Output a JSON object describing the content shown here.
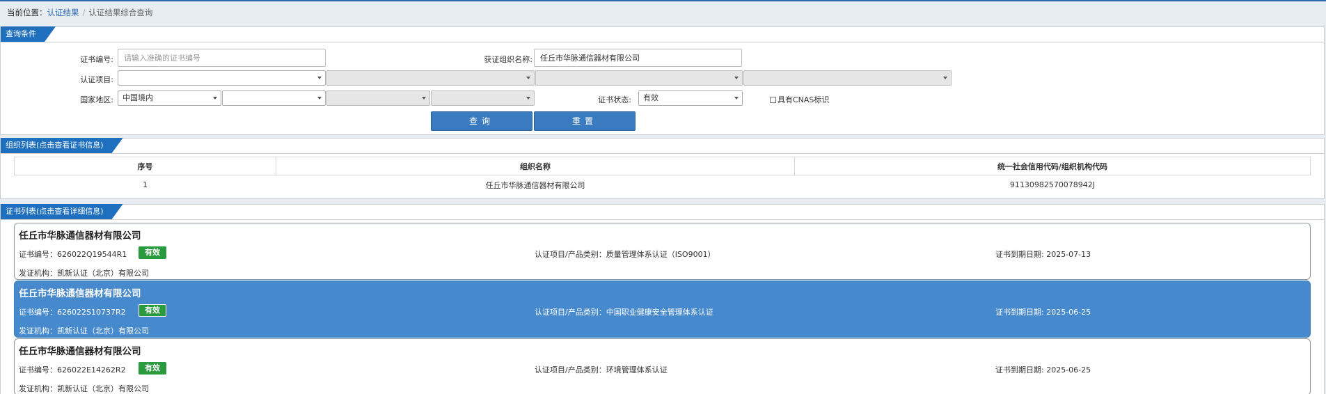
{
  "breadcrumb": {
    "prefix": "当前位置：",
    "link": "认证结果",
    "separator": "/",
    "current": "认证结果综合查询"
  },
  "query_panel": {
    "title": "查询条件",
    "cert_no_label": "证书编号:",
    "cert_no_value": "",
    "cert_no_placeholder": "请输入准确的证书编号",
    "org_name_label": "获证组织名称:",
    "org_name_value": "任丘市华脉通信器材有限公司",
    "cert_item_label": "认证项目:",
    "country_label": "国家地区:",
    "country_value": "中国境内",
    "status_label": "证书状态:",
    "status_value": "有效",
    "cnas_label": "具有CNAS标识",
    "search_button": "查询",
    "reset_button": "重置"
  },
  "org_panel": {
    "title": "组织列表(点击查看证书信息)",
    "columns": [
      "序号",
      "组织名称",
      "统一社会信用代码/组织机构代码"
    ],
    "rows": [
      {
        "index": "1",
        "name": "任丘市华脉通信器材有限公司",
        "code": "91130982570078942J"
      }
    ]
  },
  "cert_panel": {
    "title": "证书列表(点击查看详细信息)",
    "certs": [
      {
        "org": "任丘市华脉通信器材有限公司",
        "cert_no": "证书编号：626022Q19544R1",
        "status": "有效",
        "category": "认证项目/产品类别：质量管理体系认证（ISO9001）",
        "expiry": "证书到期日期: 2025-07-13",
        "issuer": "发证机构：凯新认证（北京）有限公司"
      },
      {
        "org": "任丘市华脉通信器材有限公司",
        "cert_no": "证书编号：626022S10737R2",
        "status": "有效",
        "category": "认证项目/产品类别：中国职业健康安全管理体系认证",
        "expiry": "证书到期日期: 2025-06-25",
        "issuer": "发证机构：凯新认证（北京）有限公司"
      },
      {
        "org": "任丘市华脉通信器材有限公司",
        "cert_no": "证书编号：626022E14262R2",
        "status": "有效",
        "category": "认证项目/产品类别：环境管理体系认证",
        "expiry": "证书到期日期: 2025-06-25",
        "issuer": "发证机构：凯新认证（北京）有限公司"
      }
    ]
  },
  "colors": {
    "accent": "#1f6fbf",
    "button": "#3a7bbf",
    "active_card": "#4689cc",
    "status_green": "#2a9a3e"
  }
}
